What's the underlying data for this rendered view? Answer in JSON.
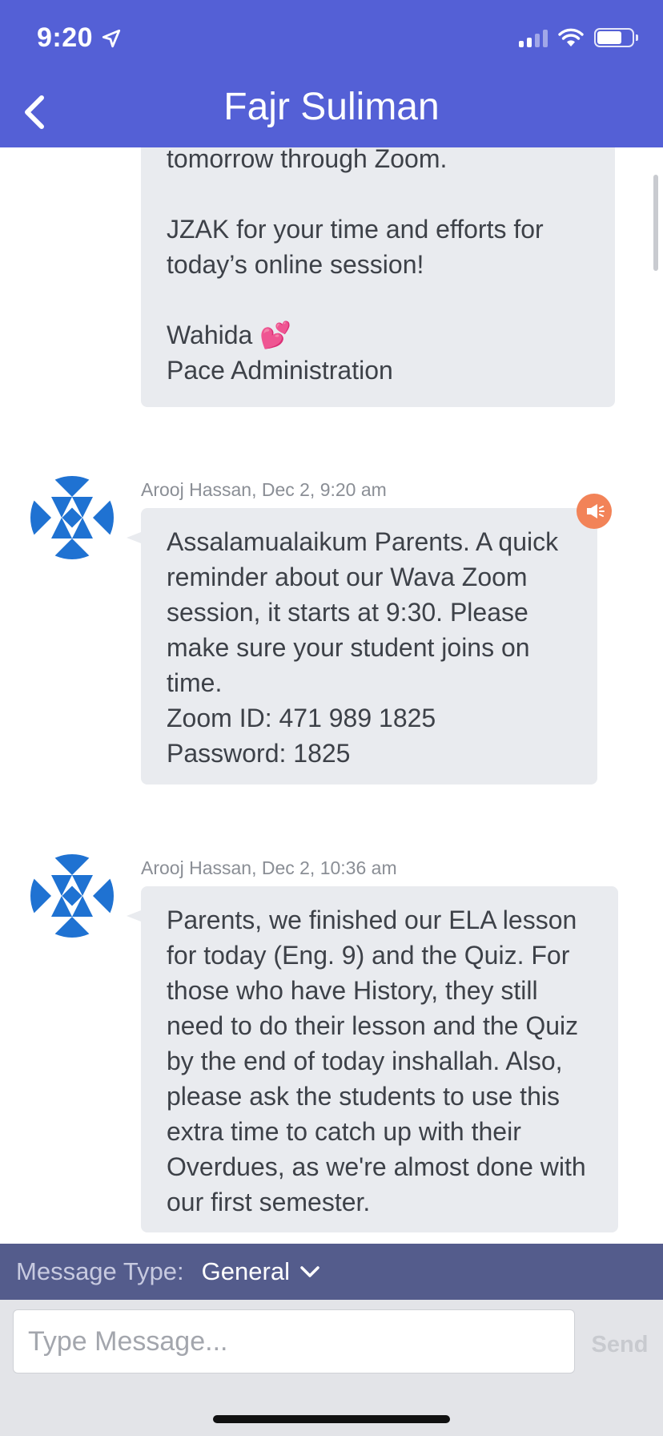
{
  "status_bar": {
    "time": "9:20"
  },
  "header": {
    "title": "Fajr Suliman",
    "back_icon": "chevron-left-icon"
  },
  "messages": [
    {
      "text": "tomorrow through Zoom.\n\nJZAK for your time and efforts for today’s online session!\n\nWahida 💕\nPace Administration"
    },
    {
      "meta": "Arooj Hassan, Dec 2, 9:20 am",
      "text": "Assalamualaikum Parents. A quick reminder about our Wava Zoom session, it starts at 9:30. Please make sure your student joins on time.\nZoom ID: 471 989 1825\nPassword: 1825",
      "announcement_icon": "megaphone-icon"
    },
    {
      "meta": "Arooj Hassan, Dec 2, 10:36 am",
      "text": "Parents, we finished our ELA lesson for today (Eng. 9) and the Quiz. For those who have History, they still need to do their lesson and the Quiz by the end of today inshallah. Also, please ask the students to use this extra time to catch up with their Overdues, as we're almost done with our first semester."
    }
  ],
  "message_type": {
    "label": "Message Type:",
    "value": "General"
  },
  "composer": {
    "placeholder": "Type Message...",
    "send_label": "Send"
  },
  "colors": {
    "header": "#5460d6",
    "type_bar": "#545c8c",
    "bubble": "#e9ebef",
    "announcement": "#f28358",
    "avatar_blue": "#1f72d2"
  }
}
